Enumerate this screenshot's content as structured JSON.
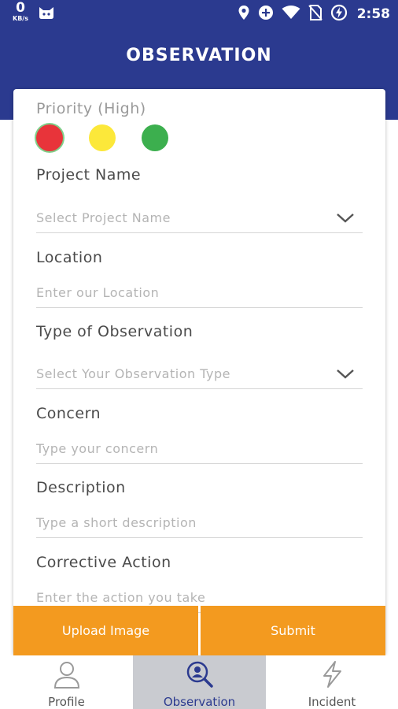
{
  "status_bar": {
    "net_speed": "0",
    "net_unit": "KB/s",
    "time": "2:58"
  },
  "header": {
    "title": "OBSERVATION"
  },
  "form": {
    "priority_label": "Priority (High)",
    "priority_options": [
      "red",
      "yellow",
      "green"
    ],
    "priority_selected": "red",
    "project_name": {
      "label": "Project Name",
      "placeholder": "Select Project Name"
    },
    "location": {
      "label": "Location",
      "placeholder": "Enter our Location"
    },
    "observation_type": {
      "label": "Type of Observation",
      "placeholder": "Select Your Observation Type"
    },
    "concern": {
      "label": "Concern",
      "placeholder": "Type your concern"
    },
    "description": {
      "label": "Description",
      "placeholder": "Type a short description"
    },
    "corrective_action": {
      "label": "Corrective Action",
      "placeholder": "Enter the action you take"
    }
  },
  "actions": {
    "upload_label": "Upload Image",
    "submit_label": "Submit"
  },
  "bottom_nav": {
    "items": [
      {
        "label": "Profile",
        "icon": "person-icon"
      },
      {
        "label": "Observation",
        "icon": "person-search-icon"
      },
      {
        "label": "Incident",
        "icon": "lightning-icon"
      }
    ],
    "active": "Observation"
  },
  "colors": {
    "primary": "#2b3a8f",
    "accent": "#f39a1f",
    "priority_red": "#e8343a",
    "priority_yellow": "#fce83a",
    "priority_green": "#3caf4e"
  }
}
